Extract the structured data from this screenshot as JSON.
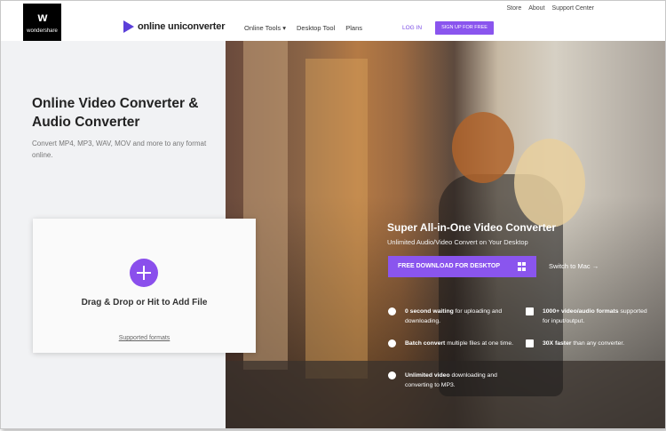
{
  "topbar": {
    "links": [
      "Store",
      "About",
      "Support Center"
    ]
  },
  "logo": {
    "mark": "w",
    "label": "wondershare"
  },
  "header": {
    "brand": "online uniconverter",
    "nav": [
      "Online Tools ▾",
      "Desktop Tool",
      "Plans"
    ],
    "login": "LOG IN",
    "signup": "SIGN UP FOR FREE"
  },
  "left": {
    "title": "Online Video Converter & Audio Converter",
    "description": "Convert MP4, MP3, WAV, MOV and more to any format online.",
    "dropzone_text": "Drag & Drop or Hit to Add File",
    "supported_link": "Supported formats"
  },
  "hero": {
    "title": "Super All-in-One Video Converter",
    "subtitle": "Unlimited Audio/Video Convert on Your Desktop",
    "download_button": "FREE DOWNLOAD FOR DESKTOP",
    "switch_link": "Switch to Mac →",
    "features": [
      {
        "bold": "0 second waiting",
        "rest": " for uploading and downloading.",
        "icon": "clock-icon"
      },
      {
        "bold": "1000+ video/audio formats",
        "rest": " supported for input/output.",
        "icon": "file-icon"
      },
      {
        "bold": "Batch convert",
        "rest": " multiple files at one time.",
        "icon": "rocket-icon"
      },
      {
        "bold": "30X faster",
        "rest": " than any converter.",
        "icon": "copy-icon"
      },
      {
        "bold": "Unlimited video",
        "rest": " downloading and converting to MP3.",
        "icon": "download-icon"
      }
    ]
  },
  "colors": {
    "accent": "#8a55ee",
    "brand_triangle": "#5b3fd9",
    "plus_button": "#8a4fec"
  }
}
